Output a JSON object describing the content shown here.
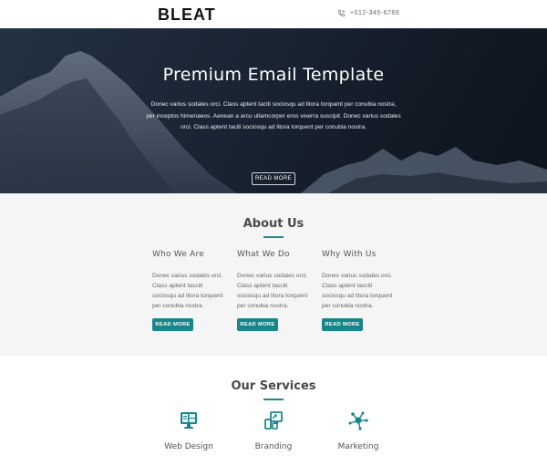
{
  "header": {
    "logo": "BLEAT",
    "phone_icon": "phone-icon",
    "phone": "+012-345-6789"
  },
  "hero": {
    "title": "Premium Email Template",
    "text": "Donec varius sodales orci. Class aptent taciti sociosqu ad litora torquent per conubia nostra, per inceptos himenaeos. Aenean a arcu ullamcorper eros viverra suscipit. Donec varius sodales orci. Class aptent taciti sociosqu ad litora torquent per conubia nostra.",
    "button": "READ MORE"
  },
  "about": {
    "title": "About Us",
    "columns": [
      {
        "heading": "Who We Are",
        "text": "Donec varius sodales orci. Class aptent tasciti sociosqu ad litora torquent per conubia nostra.",
        "button": "READ MORE"
      },
      {
        "heading": "What We Do",
        "text": "Donec varius sodales orci. Class aptent tasciti sociosqu ad litora torquent per conubia nostra.",
        "button": "READ MORE"
      },
      {
        "heading": "Why With Us",
        "text": "Donec varius sodales orci. Class aptent tasciti sociosqu ad litora torquent per conubia nostra.",
        "button": "READ MORE"
      }
    ]
  },
  "services": {
    "title": "Our Services",
    "items": [
      {
        "label": "Web Design",
        "icon": "monitor-icon"
      },
      {
        "label": "Branding",
        "icon": "devices-icon"
      },
      {
        "label": "Marketing",
        "icon": "network-icon"
      }
    ]
  },
  "colors": {
    "accent": "#17868a",
    "hero_bg": "#1e2a3a",
    "section_bg": "#f5f5f5"
  }
}
